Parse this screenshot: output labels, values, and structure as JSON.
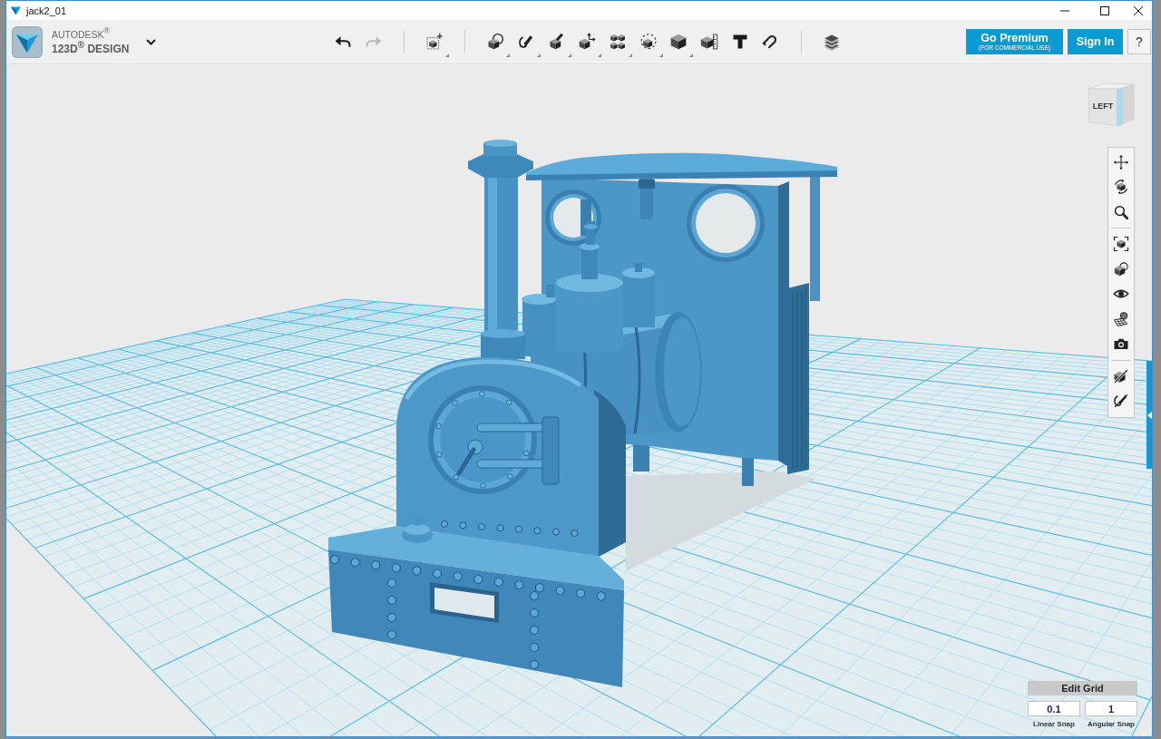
{
  "window": {
    "title": "jack2_01",
    "controls": [
      {
        "kind": "minimize"
      },
      {
        "kind": "maximize"
      },
      {
        "kind": "close"
      }
    ]
  },
  "app_menu": {
    "brand": "AUTODESK$^{®}$",
    "product": "123D$^{®}$ DESIGN"
  },
  "toolbar": {
    "groups": [
      [
        {
          "kind": "undo",
          "disabled": false,
          "has_menu": false
        },
        {
          "kind": "redo",
          "disabled": true,
          "has_menu": false
        }
      ],
      [
        {
          "kind": "primitives",
          "disabled": false,
          "has_menu": true
        }
      ],
      [
        {
          "kind": "shapes",
          "disabled": false,
          "has_menu": true
        },
        {
          "kind": "sketch",
          "disabled": false,
          "has_menu": true
        },
        {
          "kind": "construct",
          "disabled": false,
          "has_menu": true
        },
        {
          "kind": "modify",
          "disabled": false,
          "has_menu": true
        },
        {
          "kind": "pattern",
          "disabled": false,
          "has_menu": true
        },
        {
          "kind": "grouping",
          "disabled": false,
          "has_menu": true
        },
        {
          "kind": "combine",
          "disabled": false,
          "has_menu": true
        },
        {
          "kind": "measure",
          "disabled": false,
          "has_menu": false
        },
        {
          "kind": "text",
          "disabled": false,
          "has_menu": false
        },
        {
          "kind": "snap",
          "disabled": false,
          "has_menu": false
        }
      ],
      [
        {
          "kind": "material",
          "disabled": false,
          "has_menu": false
        }
      ]
    ]
  },
  "account_buttons": [
    {
      "kind": "premium",
      "label": "Go Premium",
      "note": "(FOR COMMERCIAL USE)"
    },
    {
      "kind": "signin",
      "label": "Sign In"
    },
    {
      "kind": "help",
      "label": "?"
    }
  ],
  "view_cube": {
    "face_label": "LEFT"
  },
  "navigation_bar": {
    "groups": [
      [
        {
          "kind": "pan"
        },
        {
          "kind": "orbit"
        },
        {
          "kind": "zoom"
        }
      ],
      [
        {
          "kind": "fit"
        },
        {
          "kind": "views"
        },
        {
          "kind": "visibility"
        },
        {
          "kind": "materials"
        },
        {
          "kind": "snapshot"
        }
      ],
      [
        {
          "kind": "hidesolids"
        },
        {
          "kind": "hidesketches"
        }
      ]
    ]
  },
  "side_panel_tab": {
    "expanded": false
  },
  "edit_grid": {
    "title": "Edit Grid",
    "fields": [
      {
        "value": "0.1",
        "label": "Linear Snap"
      },
      {
        "value": "1",
        "label": "Angular Snap"
      }
    ]
  }
}
